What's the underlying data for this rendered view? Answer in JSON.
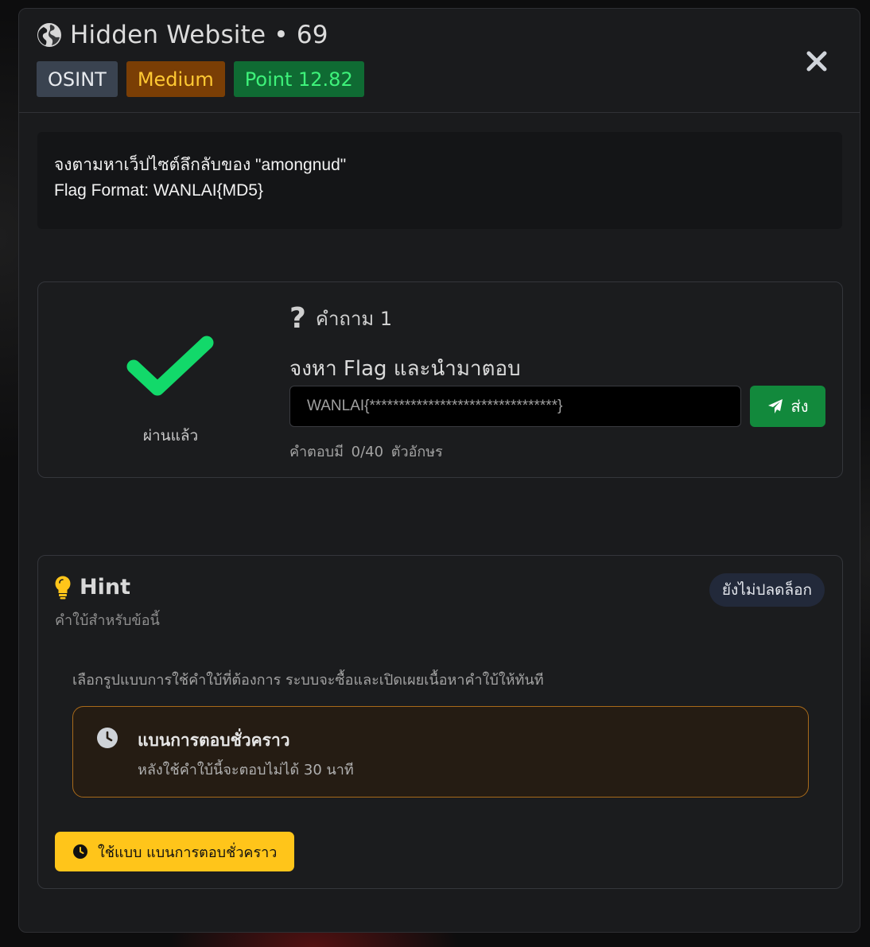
{
  "modal": {
    "title": "Hidden Website • 69",
    "badges": {
      "category": "OSINT",
      "difficulty": "Medium",
      "points": "Point 12.82"
    }
  },
  "description": {
    "line1": "จงตามหาเว็ปไซต์ลึกลับของ \"amongnud\"",
    "line2": "Flag Format: WANLAI{MD5}"
  },
  "question": {
    "status": "ผ่านแล้ว",
    "label": "คำถาม 1",
    "text": "จงหา Flag และนำมาตอบ",
    "answer_value": "WANLAI{********************************}",
    "submit_label": "ส่ง",
    "char_count": "คำตอบมี  0/40  ตัวอักษร"
  },
  "hint": {
    "title": "Hint",
    "subtitle": "คำใบ้สำหรับข้อนี้",
    "lock_status": "ยังไม่ปลดล็อก",
    "instruction": "เลือกรูปแบบการใช้คำใบ้ที่ต้องการ ระบบจะซื้อและเปิดเผยเนื้อหาคำใบ้ให้ทันที",
    "plan": {
      "title": "แบนการตอบชั่วคราว",
      "description": "หลังใช้คำใบ้นี้จะตอบไม่ได้ 30 นาที"
    },
    "use_button": "ใช้แบบ แบนการตอบชั่วคราว"
  },
  "colors": {
    "success": "#12d96a",
    "submit": "#12893c",
    "warning": "#ffc51a",
    "medium_bg": "#7a3e05",
    "points_bg": "#0f6b33"
  },
  "icons": [
    "globe-icon",
    "close-icon",
    "check-icon",
    "question-icon",
    "send-icon",
    "lightbulb-icon",
    "clock-icon"
  ]
}
